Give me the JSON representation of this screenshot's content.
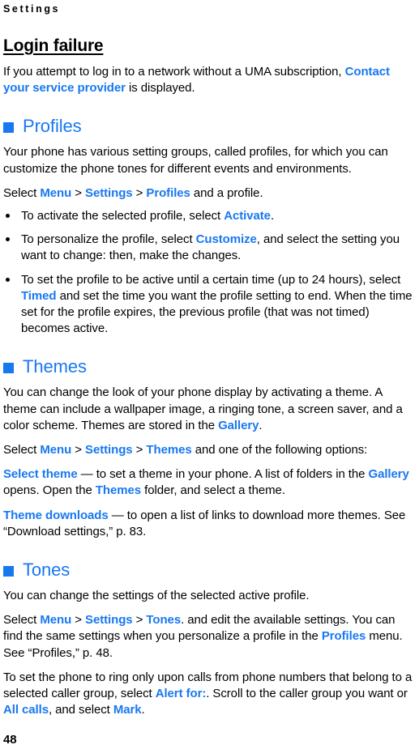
{
  "document": {
    "running_header": "Settings",
    "page_number": "48",
    "accent_color": "#1878f0",
    "text_color": "#000000",
    "background_color": "#ffffff"
  },
  "chapter": {
    "title": "Login failure",
    "intro": {
      "before": "If you attempt to log in to a network without a UMA subscription, ",
      "link": "Contact your service provider",
      "after": " is displayed."
    }
  },
  "sections": [
    {
      "id": "profiles",
      "bullet_icon": "blue-square-bullet",
      "heading": "Profiles",
      "intro": "Your phone has various setting groups, called profiles, for which you can customize the phone tones for different events and environments.",
      "select_line": {
        "select": "Select ",
        "menu": "Menu",
        "sep1": " > ",
        "settings": "Settings",
        "sep2": " > ",
        "target": "Profiles",
        "tail": " and a profile."
      },
      "bullets": [
        {
          "a": "To activate the selected profile, select ",
          "ui1": "Activate",
          "b": "."
        },
        {
          "a": "To personalize the profile, select ",
          "ui1": "Customize",
          "b": ", and select the setting you want to change: then, make the changes."
        },
        {
          "a": "To set the profile to be active until a certain time (up to 24 hours), select ",
          "ui1": "Timed",
          "b": " and set the time you want the profile setting to end. When the time set for the profile expires, the previous profile (that was not timed) becomes active."
        }
      ]
    },
    {
      "id": "themes",
      "bullet_icon": "blue-square-bullet",
      "heading": "Themes",
      "intro": {
        "a": "You can change the look of your phone display by activating a theme. A theme can include a wallpaper image, a ringing tone, a screen saver, and a color scheme. Themes are stored in the ",
        "ui1": "Gallery",
        "b": "."
      },
      "select_line": {
        "select": "Select ",
        "menu": "Menu",
        "sep1": " > ",
        "settings": "Settings",
        "sep2": " > ",
        "target": "Themes",
        "tail": " and one of the following options:"
      },
      "options": [
        {
          "term": "Select theme",
          "a": " — to set a theme in your phone. A list of folders in the ",
          "ui1": "Gallery",
          "b": " opens. Open the ",
          "ui2": "Themes",
          "c": " folder, and select a theme."
        },
        {
          "term": "Theme downloads",
          "a": " — to open a list of links to download more themes. See “Download settings,” p. 83.",
          "ui1": "",
          "b": "",
          "ui2": "",
          "c": ""
        }
      ]
    },
    {
      "id": "tones",
      "bullet_icon": "blue-square-bullet",
      "heading": "Tones",
      "intro": "You can change the settings of the selected active profile.",
      "select_line": {
        "select": "Select ",
        "menu": "Menu",
        "sep1": " > ",
        "settings": "Settings",
        "sep2": " > ",
        "target": "Tones",
        "tail": ". and edit the available settings. You can find the same settings when you personalize a profile in the "
      },
      "select_line_extra": {
        "ui": "Profiles",
        "tail": " menu. See “Profiles,” p. 48."
      },
      "closing": {
        "a": "To set the phone to ring only upon calls from phone numbers that belong to a selected caller group, select ",
        "ui1": "Alert for:",
        "b": ". Scroll to the caller group you want or ",
        "ui2": "All calls",
        "c": ", and select ",
        "ui3": "Mark",
        "d": "."
      }
    }
  ]
}
